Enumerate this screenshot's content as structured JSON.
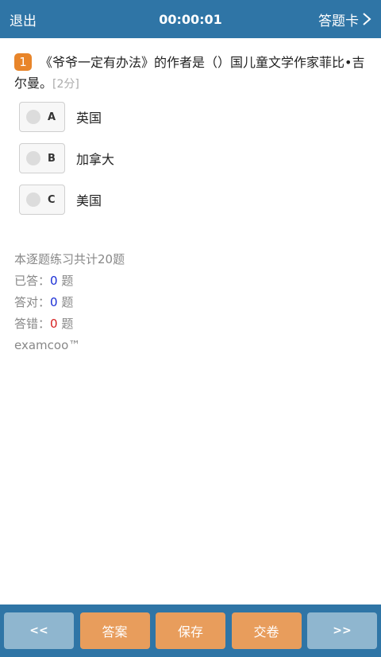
{
  "header": {
    "exit_label": "退出",
    "timer": "00:00:01",
    "answer_card_label": "答题卡"
  },
  "question": {
    "number": "1",
    "text": "《爷爷一定有办法》的作者是（）国儿童文学作家菲比•吉尔曼。",
    "score": "[2分]"
  },
  "options": [
    {
      "letter": "A",
      "text": "英国"
    },
    {
      "letter": "B",
      "text": "加拿大"
    },
    {
      "letter": "C",
      "text": "美国"
    }
  ],
  "stats": {
    "total_text": "本逐题练习共计20题",
    "answered_label": "已答：",
    "answered_count": "0",
    "correct_label": "答对：",
    "correct_count": "0",
    "wrong_label": "答错：",
    "wrong_count": "0",
    "unit": "题",
    "brand": "examcoo™"
  },
  "footer": {
    "prev": "<<",
    "answer": "答案",
    "save": "保存",
    "submit": "交卷",
    "next": ">>"
  },
  "colors": {
    "bar": "#2f75a6",
    "accent_orange": "#e8852a",
    "button_orange": "#e89d5c",
    "nav_button": "#8fb6cf"
  }
}
